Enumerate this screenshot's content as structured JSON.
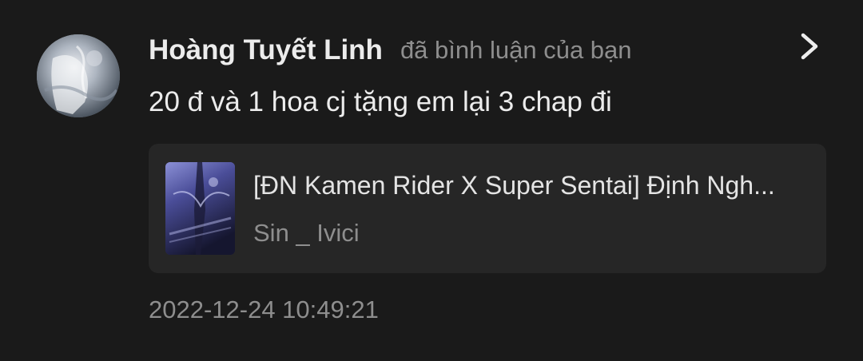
{
  "notification": {
    "user_name": "Hoàng Tuyết Linh",
    "action_text": "đã bình luận của bạn",
    "comment": "20 đ và 1 hoa cj tặng em lại 3 chap đi",
    "story": {
      "title": "[ĐN Kamen Rider X Super Sentai] Định Ngh...",
      "author": "Sin _ Ivici"
    },
    "timestamp": "2022-12-24 10:49:21"
  },
  "icons": {
    "avatar": "avatar",
    "chevron": "chevron-right-icon",
    "cover": "story-cover-thumbnail"
  },
  "colors": {
    "background": "#1a1a1a",
    "card_background": "#262626",
    "primary_text": "#ececec",
    "secondary_text": "#8e8e8e"
  }
}
